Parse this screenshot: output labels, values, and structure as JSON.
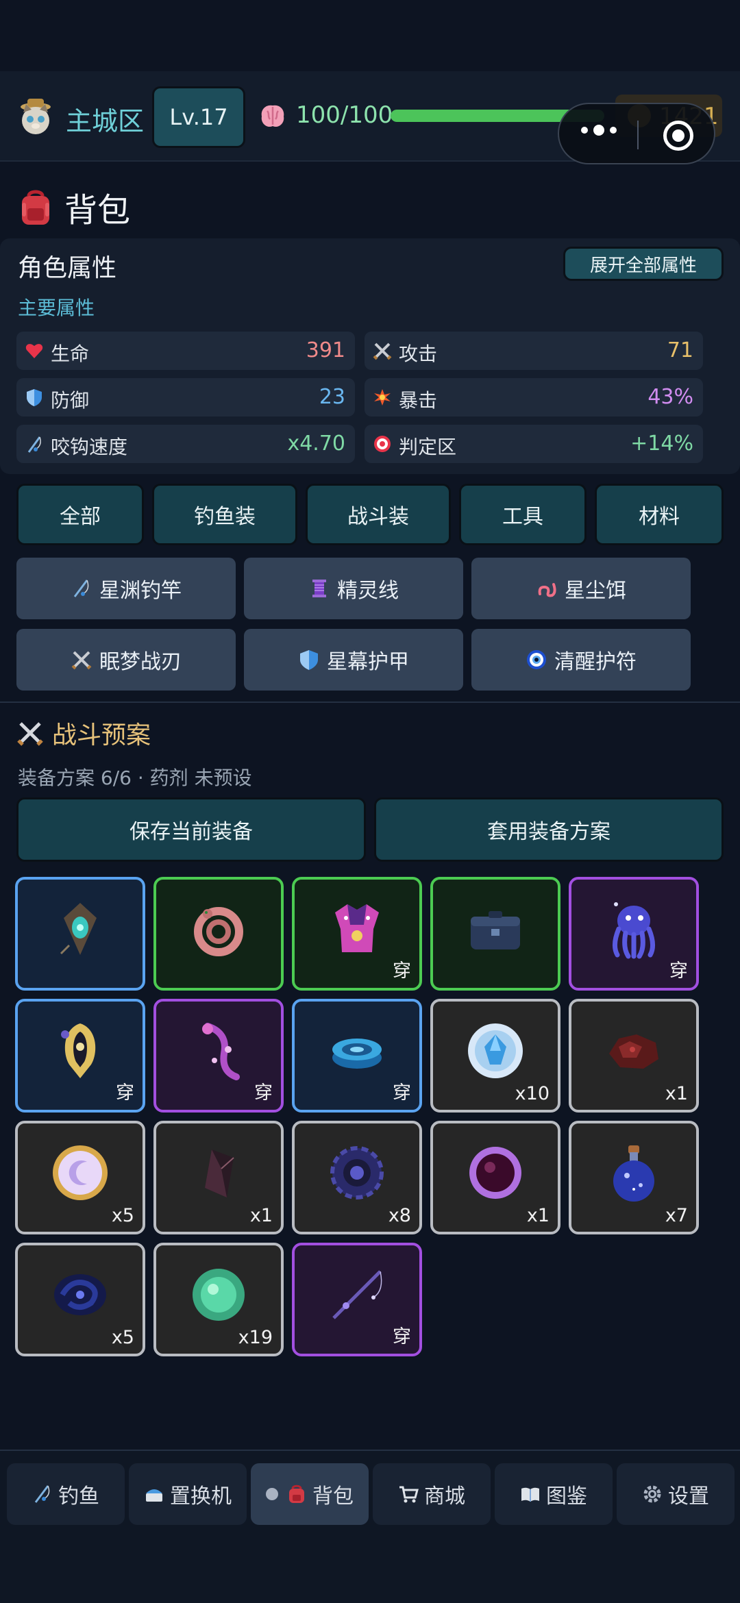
{
  "header": {
    "zone": "主城区",
    "level": "Lv.17",
    "energy": "100/100",
    "energy_fraction": 1.0,
    "coins": "1421"
  },
  "page": {
    "title": "背包"
  },
  "attributes": {
    "title": "角色属性",
    "expand_button": "展开全部属性",
    "subtitle": "主要属性",
    "stats": [
      {
        "icon": "heart-icon",
        "label": "生命",
        "value": "391",
        "color": "#f08a8a"
      },
      {
        "icon": "crossed-swords-icon",
        "label": "攻击",
        "value": "71",
        "color": "#e8c06a"
      },
      {
        "icon": "shield-icon",
        "label": "防御",
        "value": "23",
        "color": "#6ab7f0"
      },
      {
        "icon": "burst-icon",
        "label": "暴击",
        "value": "43%",
        "color": "#d18cf0"
      },
      {
        "icon": "fishing-rod-icon",
        "label": "咬钩速度",
        "value": "x4.70",
        "color": "#7fd9a5"
      },
      {
        "icon": "target-icon",
        "label": "判定区",
        "value": "+14%",
        "color": "#7fd9a5"
      }
    ]
  },
  "tabs": [
    "全部",
    "钓鱼装",
    "战斗装",
    "工具",
    "材料"
  ],
  "equipment_slots": [
    {
      "icon": "fishing-rod-icon",
      "label": "星渊钓竿"
    },
    {
      "icon": "spool-icon",
      "label": "精灵线"
    },
    {
      "icon": "worm-icon",
      "label": "星尘饵"
    },
    {
      "icon": "crossed-swords-icon",
      "label": "眠梦战刃"
    },
    {
      "icon": "shield-icon",
      "label": "星幕护甲"
    },
    {
      "icon": "evil-eye-icon",
      "label": "清醒护符"
    }
  ],
  "battle_plan": {
    "title": "战斗预案",
    "status": "装备方案 6/6 · 药剂 未预设",
    "save_button": "保存当前装备",
    "apply_button": "套用装备方案"
  },
  "inventory": [
    {
      "icon": "amulet-icon",
      "rarity": "blue",
      "tag": ""
    },
    {
      "icon": "worm-bait-icon",
      "rarity": "green",
      "tag": ""
    },
    {
      "icon": "star-armor-icon",
      "rarity": "green",
      "tag": "穿"
    },
    {
      "icon": "tackle-box-icon",
      "rarity": "green",
      "tag": ""
    },
    {
      "icon": "cosmic-octopus-icon",
      "rarity": "purple",
      "tag": "穿"
    },
    {
      "icon": "star-charm-icon",
      "rarity": "blue",
      "tag": "穿"
    },
    {
      "icon": "moon-hook-icon",
      "rarity": "purple",
      "tag": "穿"
    },
    {
      "icon": "blue-spool-icon",
      "rarity": "blue",
      "tag": "穿"
    },
    {
      "icon": "ice-crystal-icon",
      "rarity": "common",
      "tag": "x10"
    },
    {
      "icon": "red-ore-icon",
      "rarity": "common",
      "tag": "x1"
    },
    {
      "icon": "moon-coin-icon",
      "rarity": "common",
      "tag": "x5"
    },
    {
      "icon": "dark-shard-icon",
      "rarity": "common",
      "tag": "x1"
    },
    {
      "icon": "dark-gear-icon",
      "rarity": "common",
      "tag": "x8"
    },
    {
      "icon": "void-orb-icon",
      "rarity": "common",
      "tag": "x1"
    },
    {
      "icon": "potion-icon",
      "rarity": "common",
      "tag": "x7"
    },
    {
      "icon": "dark-nebula-icon",
      "rarity": "common",
      "tag": "x5"
    },
    {
      "icon": "green-orb-icon",
      "rarity": "common",
      "tag": "x19"
    },
    {
      "icon": "star-rod-icon",
      "rarity": "purple",
      "tag": "穿"
    }
  ],
  "nav": [
    {
      "icon": "fishing-rod-icon",
      "label": "钓鱼"
    },
    {
      "icon": "machine-icon",
      "label": "置换机"
    },
    {
      "icon": "backpack-icon",
      "label": "背包",
      "active": true
    },
    {
      "icon": "cart-icon",
      "label": "商城"
    },
    {
      "icon": "book-icon",
      "label": "图鉴"
    },
    {
      "icon": "gear-icon",
      "label": "设置"
    }
  ],
  "colors": {
    "background": "#0d1422",
    "accent_teal": "#1d4d5a",
    "rarity_blue": "#5aa3f0",
    "rarity_green": "#4ccb52",
    "rarity_purple": "#a24fe0",
    "rarity_common": "#b9bcc2"
  }
}
